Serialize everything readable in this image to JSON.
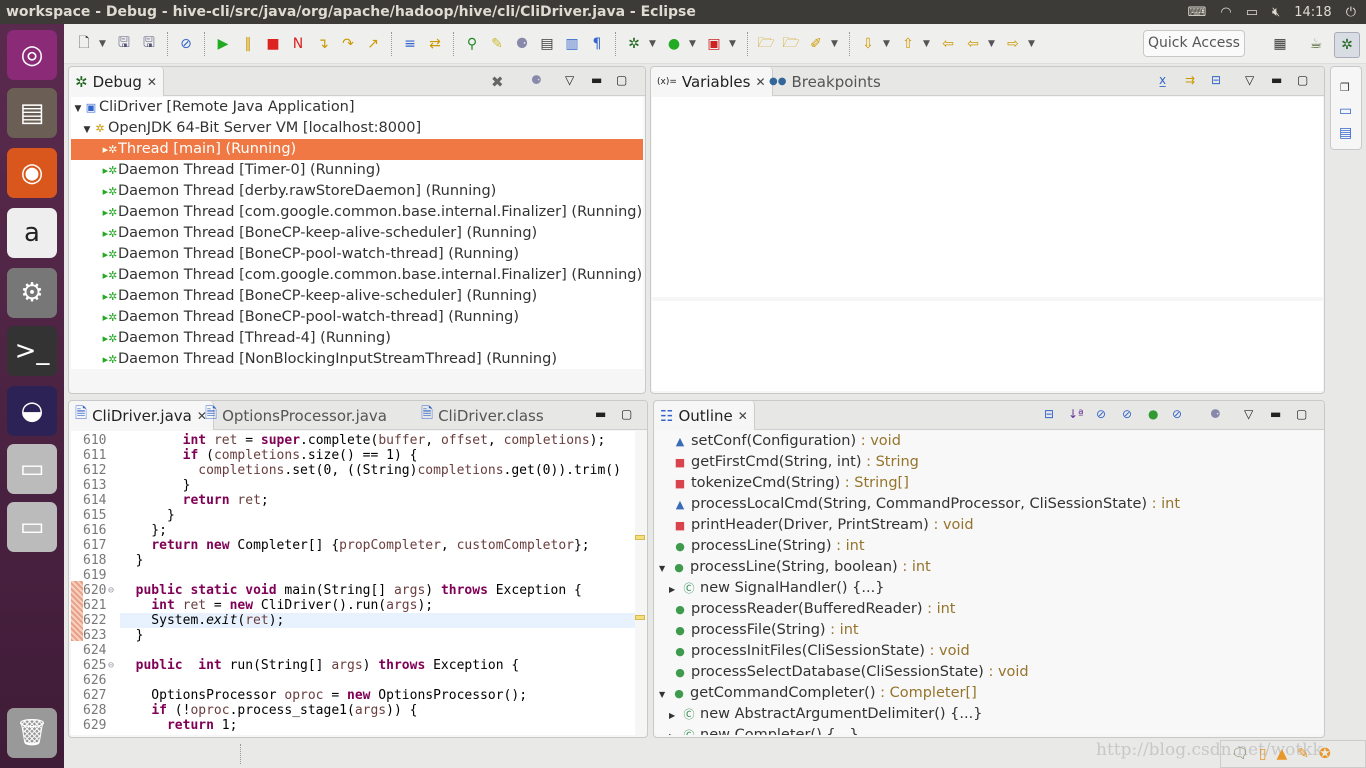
{
  "window": {
    "title": "workspace - Debug - hive-cli/src/java/org/apache/hadoop/hive/cli/CliDriver.java - Eclipse"
  },
  "tray": {
    "time": "14:18",
    "icons": [
      "keyboard-icon",
      "wifi-icon",
      "battery-icon",
      "volume-muted-icon",
      "power-icon"
    ]
  },
  "launcher": {
    "items": [
      "ubuntu-dash-icon",
      "files-icon",
      "firefox-icon",
      "amazon-icon",
      "settings-icon",
      "terminal-icon",
      "eclipse-icon",
      "disk-icon",
      "disk-icon",
      "trash-icon"
    ]
  },
  "toolbar": {
    "quick_access": "Quick Access"
  },
  "debug_view": {
    "tab": "Debug",
    "rows": [
      {
        "label": "CliDriver [Remote Java Application]",
        "level": 0,
        "icon": "launch-icon",
        "expanded": true
      },
      {
        "label": "OpenJDK 64-Bit Server VM [localhost:8000]",
        "level": 1,
        "icon": "vm-icon",
        "expanded": true
      },
      {
        "label": "Thread [main] (Running)",
        "level": 2,
        "icon": "thread-running-icon",
        "selected": true
      },
      {
        "label": "Daemon Thread [Timer-0] (Running)",
        "level": 2,
        "icon": "thread-running-icon"
      },
      {
        "label": "Daemon Thread [derby.rawStoreDaemon] (Running)",
        "level": 2,
        "icon": "thread-running-icon"
      },
      {
        "label": "Daemon Thread [com.google.common.base.internal.Finalizer] (Running)",
        "level": 2,
        "icon": "thread-running-icon"
      },
      {
        "label": "Daemon Thread [BoneCP-keep-alive-scheduler] (Running)",
        "level": 2,
        "icon": "thread-running-icon"
      },
      {
        "label": "Daemon Thread [BoneCP-pool-watch-thread] (Running)",
        "level": 2,
        "icon": "thread-running-icon"
      },
      {
        "label": "Daemon Thread [com.google.common.base.internal.Finalizer] (Running)",
        "level": 2,
        "icon": "thread-running-icon"
      },
      {
        "label": "Daemon Thread [BoneCP-keep-alive-scheduler] (Running)",
        "level": 2,
        "icon": "thread-running-icon"
      },
      {
        "label": "Daemon Thread [BoneCP-pool-watch-thread] (Running)",
        "level": 2,
        "icon": "thread-running-icon"
      },
      {
        "label": "Daemon Thread [Thread-4] (Running)",
        "level": 2,
        "icon": "thread-running-icon"
      },
      {
        "label": "Daemon Thread [NonBlockingInputStreamThread] (Running)",
        "level": 2,
        "icon": "thread-running-icon"
      }
    ]
  },
  "variables_view": {
    "tabs": [
      "Variables",
      "Breakpoints"
    ]
  },
  "editor": {
    "tabs": [
      "CliDriver.java",
      "OptionsProcessor.java",
      "CliDriver.class"
    ],
    "current_line": 622,
    "lines": [
      {
        "n": "610",
        "t": [
          [
            "",
            "        "
          ],
          [
            "kw",
            "int"
          ],
          [
            "tx",
            " "
          ],
          [
            "lv",
            "ret"
          ],
          [
            "tx",
            " = "
          ],
          [
            "kw",
            "super"
          ],
          [
            "tx",
            ".complete("
          ],
          [
            "lv",
            "buffer"
          ],
          [
            "tx",
            ", "
          ],
          [
            "lv",
            "offset"
          ],
          [
            "tx",
            ", "
          ],
          [
            "lv",
            "completions"
          ],
          [
            "tx",
            ");"
          ]
        ]
      },
      {
        "n": "611",
        "t": [
          [
            "",
            "        "
          ],
          [
            "kw",
            "if"
          ],
          [
            "tx",
            " ("
          ],
          [
            "lv",
            "completions"
          ],
          [
            "tx",
            ".size() == 1) {"
          ]
        ]
      },
      {
        "n": "612",
        "t": [
          [
            "",
            "          "
          ],
          [
            "lv",
            "completions"
          ],
          [
            "tx",
            ".set(0, ((String)"
          ],
          [
            "lv",
            "completions"
          ],
          [
            "tx",
            ".get(0)).trim()"
          ]
        ]
      },
      {
        "n": "613",
        "t": [
          [
            "tx",
            "        }"
          ]
        ]
      },
      {
        "n": "614",
        "t": [
          [
            "",
            "        "
          ],
          [
            "kw",
            "return"
          ],
          [
            "tx",
            " "
          ],
          [
            "lv",
            "ret"
          ],
          [
            "tx",
            ";"
          ]
        ]
      },
      {
        "n": "615",
        "t": [
          [
            "tx",
            "      }"
          ]
        ]
      },
      {
        "n": "616",
        "t": [
          [
            "tx",
            "    };"
          ]
        ]
      },
      {
        "n": "617",
        "t": [
          [
            "",
            "    "
          ],
          [
            "kw",
            "return"
          ],
          [
            "tx",
            " "
          ],
          [
            "kw",
            "new"
          ],
          [
            "tx",
            " Completer[] {"
          ],
          [
            "lv",
            "propCompleter"
          ],
          [
            "tx",
            ", "
          ],
          [
            "lv",
            "customCompletor"
          ],
          [
            "tx",
            "};"
          ]
        ]
      },
      {
        "n": "618",
        "t": [
          [
            "tx",
            "  }"
          ]
        ]
      },
      {
        "n": "619",
        "t": []
      },
      {
        "n": "620",
        "fold": true,
        "t": [
          [
            "",
            "  "
          ],
          [
            "kw",
            "public"
          ],
          [
            "tx",
            " "
          ],
          [
            "kw",
            "static"
          ],
          [
            "tx",
            " "
          ],
          [
            "kw",
            "void"
          ],
          [
            "tx",
            " main(String[] "
          ],
          [
            "lv",
            "args"
          ],
          [
            "tx",
            ") "
          ],
          [
            "kw",
            "throws"
          ],
          [
            "tx",
            " Exception {"
          ]
        ]
      },
      {
        "n": "621",
        "t": [
          [
            "",
            "    "
          ],
          [
            "kw",
            "int"
          ],
          [
            "tx",
            " "
          ],
          [
            "lv",
            "ret"
          ],
          [
            "tx",
            " = "
          ],
          [
            "kw",
            "new"
          ],
          [
            "tx",
            " CliDriver().run("
          ],
          [
            "lv",
            "args"
          ],
          [
            "tx",
            ");"
          ]
        ]
      },
      {
        "n": "622",
        "t": [
          [
            "tx",
            "    System."
          ],
          [
            "it",
            "exit"
          ],
          [
            "tx",
            "("
          ],
          [
            "lv",
            "ret"
          ],
          [
            "tx",
            ");"
          ]
        ]
      },
      {
        "n": "623",
        "t": [
          [
            "tx",
            "  }"
          ]
        ]
      },
      {
        "n": "624",
        "t": []
      },
      {
        "n": "625",
        "fold": true,
        "t": [
          [
            "",
            "  "
          ],
          [
            "kw",
            "public"
          ],
          [
            "tx",
            "  "
          ],
          [
            "kw",
            "int"
          ],
          [
            "tx",
            " run(String[] "
          ],
          [
            "lv",
            "args"
          ],
          [
            "tx",
            ") "
          ],
          [
            "kw",
            "throws"
          ],
          [
            "tx",
            " Exception {"
          ]
        ]
      },
      {
        "n": "626",
        "t": []
      },
      {
        "n": "627",
        "t": [
          [
            "tx",
            "    OptionsProcessor "
          ],
          [
            "lv",
            "oproc"
          ],
          [
            "tx",
            " = "
          ],
          [
            "kw",
            "new"
          ],
          [
            "tx",
            " OptionsProcessor();"
          ]
        ]
      },
      {
        "n": "628",
        "t": [
          [
            "",
            "    "
          ],
          [
            "kw",
            "if"
          ],
          [
            "tx",
            " (!"
          ],
          [
            "lv",
            "oproc"
          ],
          [
            "tx",
            ".process_stage1("
          ],
          [
            "lv",
            "args"
          ],
          [
            "tx",
            ")) {"
          ]
        ]
      },
      {
        "n": "629",
        "t": [
          [
            "",
            "      "
          ],
          [
            "kw",
            "return"
          ],
          [
            "tx",
            " 1;"
          ]
        ]
      }
    ]
  },
  "outline": {
    "tab": "Outline",
    "items": [
      {
        "name": "setConf(Configuration)",
        "ret": " : void",
        "vis": "default",
        "level": 0
      },
      {
        "name": "getFirstCmd(String, int)",
        "ret": " : String",
        "vis": "private",
        "level": 0
      },
      {
        "name": "tokenizeCmd(String)",
        "ret": " : String[]",
        "vis": "private",
        "level": 0
      },
      {
        "name": "processLocalCmd(String, CommandProcessor, CliSessionState)",
        "ret": " : int",
        "vis": "default",
        "level": 0
      },
      {
        "name": "printHeader(Driver, PrintStream)",
        "ret": " : void",
        "vis": "private",
        "level": 0
      },
      {
        "name": "processLine(String)",
        "ret": " : int",
        "vis": "public",
        "level": 0
      },
      {
        "name": "processLine(String, boolean)",
        "ret": " : int",
        "vis": "public",
        "level": 0,
        "expanded": true
      },
      {
        "name": "new SignalHandler() {...}",
        "ret": "",
        "vis": "anon",
        "level": 1
      },
      {
        "name": "processReader(BufferedReader)",
        "ret": " : int",
        "vis": "public",
        "level": 0
      },
      {
        "name": "processFile(String)",
        "ret": " : int",
        "vis": "public",
        "level": 0
      },
      {
        "name": "processInitFiles(CliSessionState)",
        "ret": " : void",
        "vis": "public",
        "level": 0
      },
      {
        "name": "processSelectDatabase(CliSessionState)",
        "ret": " : void",
        "vis": "public",
        "level": 0
      },
      {
        "name": "getCommandCompleter()",
        "ret": " : Completer[]",
        "vis": "public",
        "level": 0,
        "expanded": true
      },
      {
        "name": "new AbstractArgumentDelimiter() {...}",
        "ret": "",
        "vis": "anon",
        "level": 1
      },
      {
        "name": "new Completer() {...}",
        "ret": "",
        "vis": "anon",
        "level": 1
      }
    ]
  },
  "watermark": "http://blog.csdn.net/wotkk",
  "colors": {
    "selection": "#ef7844",
    "keyword": "#7f0055",
    "local_variable": "#6a3e3e",
    "return_type": "#95742c"
  }
}
